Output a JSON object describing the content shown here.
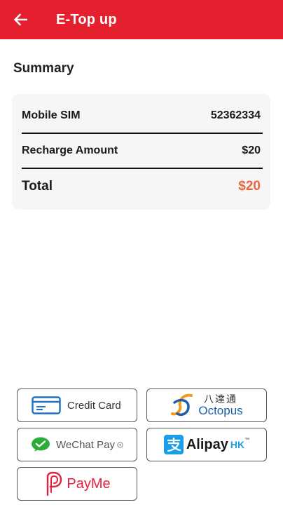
{
  "header": {
    "title": "E-Top up",
    "bar_color": "#e5202e",
    "back_icon": "arrow-left-icon"
  },
  "summary": {
    "title": "Summary",
    "rows": [
      {
        "label": "Mobile SIM",
        "value": "52362334"
      },
      {
        "label": "Recharge Amount",
        "value": "$20"
      }
    ],
    "total": {
      "label": "Total",
      "value": "$20",
      "color": "#e9663f"
    }
  },
  "payment_methods": [
    {
      "id": "credit-card",
      "label": "Credit Card",
      "icon": "credit-card-icon"
    },
    {
      "id": "octopus",
      "label_chinese": "八達通",
      "label": "Octopus",
      "icon": "octopus-logo"
    },
    {
      "id": "wechat-pay",
      "label": "WeChat Pay",
      "icon": "wechat-logo"
    },
    {
      "id": "alipay-hk",
      "label": "Alipay",
      "label_suffix": "HK",
      "trademark": "™",
      "icon": "alipay-logo"
    },
    {
      "id": "payme",
      "label": "PayMe",
      "icon": "payme-logo"
    }
  ]
}
